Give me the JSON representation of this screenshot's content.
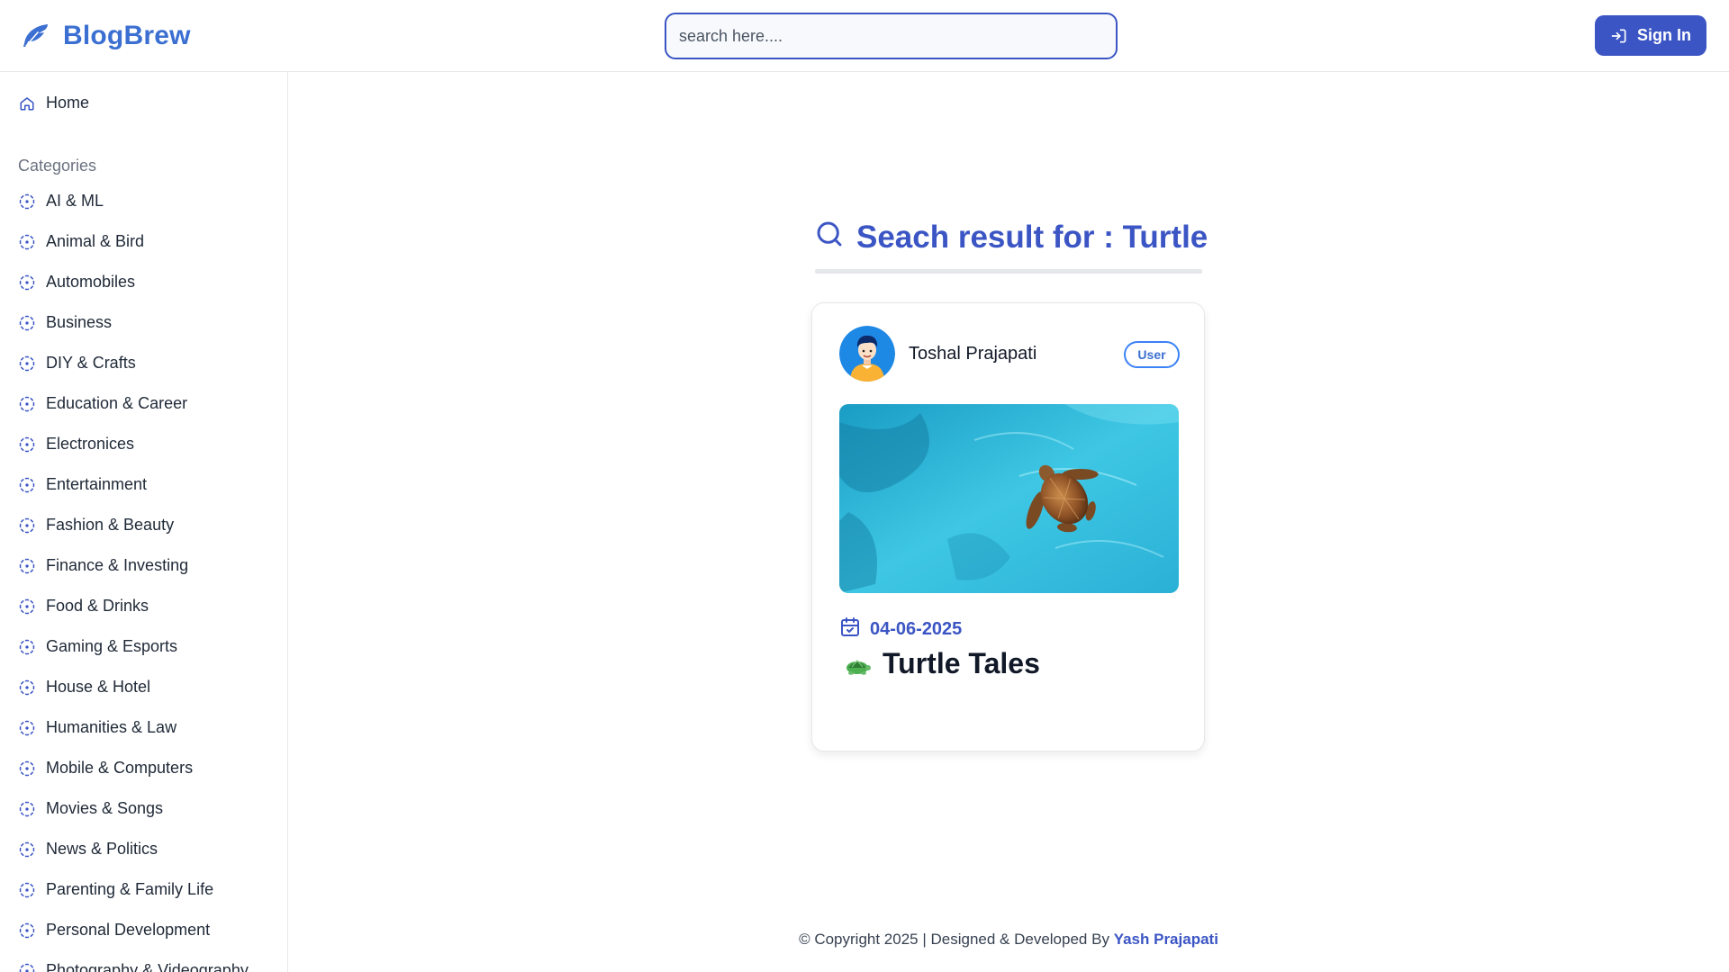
{
  "header": {
    "brand": "BlogBrew",
    "search_placeholder": "search here....",
    "signin_label": "Sign In"
  },
  "sidebar": {
    "home_label": "Home",
    "categories_heading": "Categories",
    "categories": [
      "AI & ML",
      "Animal & Bird",
      "Automobiles",
      "Business",
      "DIY & Crafts",
      "Education & Career",
      "Electronices",
      "Entertainment",
      "Fashion & Beauty",
      "Finance & Investing",
      "Food & Drinks",
      "Gaming & Esports",
      "House & Hotel",
      "Humanities & Law",
      "Mobile & Computers",
      "Movies & Songs",
      "News & Politics",
      "Parenting & Family Life",
      "Personal Development",
      "Photography & Videography"
    ]
  },
  "main": {
    "result_title": "Seach result for : Turtle",
    "card": {
      "author_name": "Toshal Prajapati",
      "role_badge": "User",
      "date": "04-06-2025",
      "title": "Turtle Tales",
      "image_alt": "sea turtle swimming in turquoise water"
    }
  },
  "footer": {
    "copyright": "© Copyright 2025 | Designed & Developed By",
    "developer": "Yash Prajapati"
  },
  "colors": {
    "accent": "#3b55c4",
    "brand": "#3b6fd1",
    "badge_border": "#3b82f6"
  }
}
